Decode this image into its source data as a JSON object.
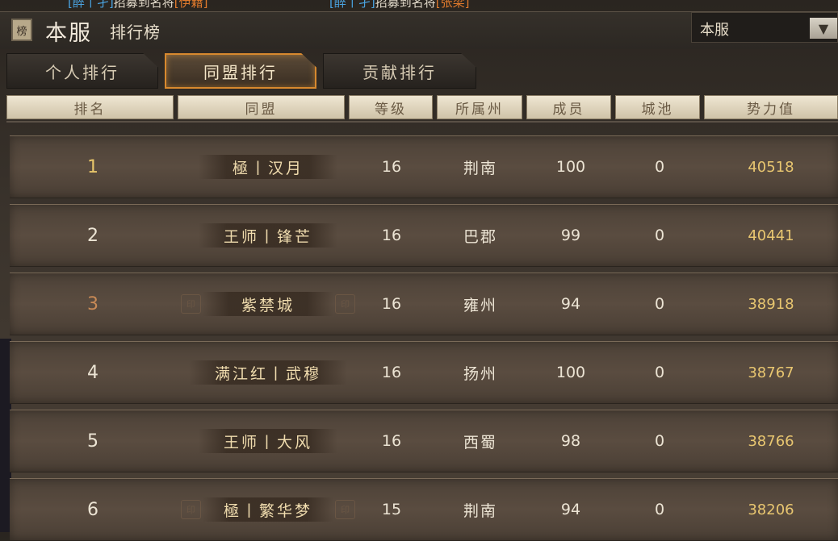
{
  "marquee": [
    {
      "prefix": "[醉丨孑]",
      "text": "招募到名将",
      "hero": "[伊籍]"
    },
    {
      "prefix": "[醉丨孑]",
      "text": "招募到名将",
      "hero": "[张梁]"
    }
  ],
  "header": {
    "icon_glyph": "榜",
    "title": "本服",
    "subtitle": "排行榜"
  },
  "server_select": {
    "value": "本服",
    "arrow": "▼"
  },
  "tabs": [
    {
      "label": "个人排行",
      "active": false
    },
    {
      "label": "同盟排行",
      "active": true
    },
    {
      "label": "贡献排行",
      "active": false
    }
  ],
  "columns": [
    "排名",
    "同盟",
    "等级",
    "所属州",
    "成员",
    "城池",
    "势力值"
  ],
  "seal_glyph": "印",
  "rows": [
    {
      "rank": "1",
      "alliance": "極丨汉月",
      "level": "16",
      "region": "荆南",
      "members": "100",
      "cities": "0",
      "power": "40518"
    },
    {
      "rank": "2",
      "alliance": "王师丨锋芒",
      "level": "16",
      "region": "巴郡",
      "members": "99",
      "cities": "0",
      "power": "40441"
    },
    {
      "rank": "3",
      "alliance": "紫禁城",
      "level": "16",
      "region": "雍州",
      "members": "94",
      "cities": "0",
      "power": "38918"
    },
    {
      "rank": "4",
      "alliance": "满江红丨武穆",
      "level": "16",
      "region": "扬州",
      "members": "100",
      "cities": "0",
      "power": "38767"
    },
    {
      "rank": "5",
      "alliance": "王师丨大风",
      "level": "16",
      "region": "西蜀",
      "members": "98",
      "cities": "0",
      "power": "38766"
    },
    {
      "rank": "6",
      "alliance": "極丨繁华梦",
      "level": "15",
      "region": "荆南",
      "members": "94",
      "cities": "0",
      "power": "38206"
    }
  ],
  "colors": {
    "accent_tab": "#d8892e",
    "power_text": "#e8c670",
    "rank1": "#e8c66a",
    "rank3": "#c88a56"
  }
}
